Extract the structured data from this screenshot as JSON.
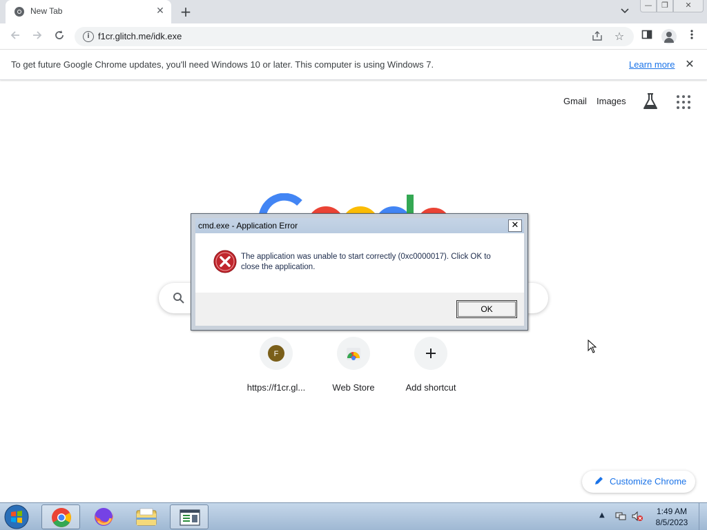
{
  "browser": {
    "tab_title": "New Tab",
    "url": "f1cr.glitch.me/idk.exe"
  },
  "infobar": {
    "message": "To get future Google Chrome updates, you'll need Windows 10 or later. This computer is using Windows 7.",
    "learn_more": "Learn more"
  },
  "ntp": {
    "gmail": "Gmail",
    "images": "Images",
    "shortcuts": [
      {
        "label": "https://f1cr.gl...",
        "letter": "F"
      },
      {
        "label": "Web Store"
      },
      {
        "label": "Add shortcut"
      }
    ],
    "customize": "Customize Chrome"
  },
  "dialog": {
    "title": "cmd.exe - Application Error",
    "message": "The application was unable to start correctly (0xc0000017). Click OK to close the application.",
    "ok": "OK"
  },
  "taskbar": {
    "time": "1:49 AM",
    "date": "8/5/2023"
  },
  "colors": {
    "link_blue": "#1a73e8",
    "error_red": "#c0262d",
    "shortcut_letter_bg": "#7a5f1a"
  }
}
